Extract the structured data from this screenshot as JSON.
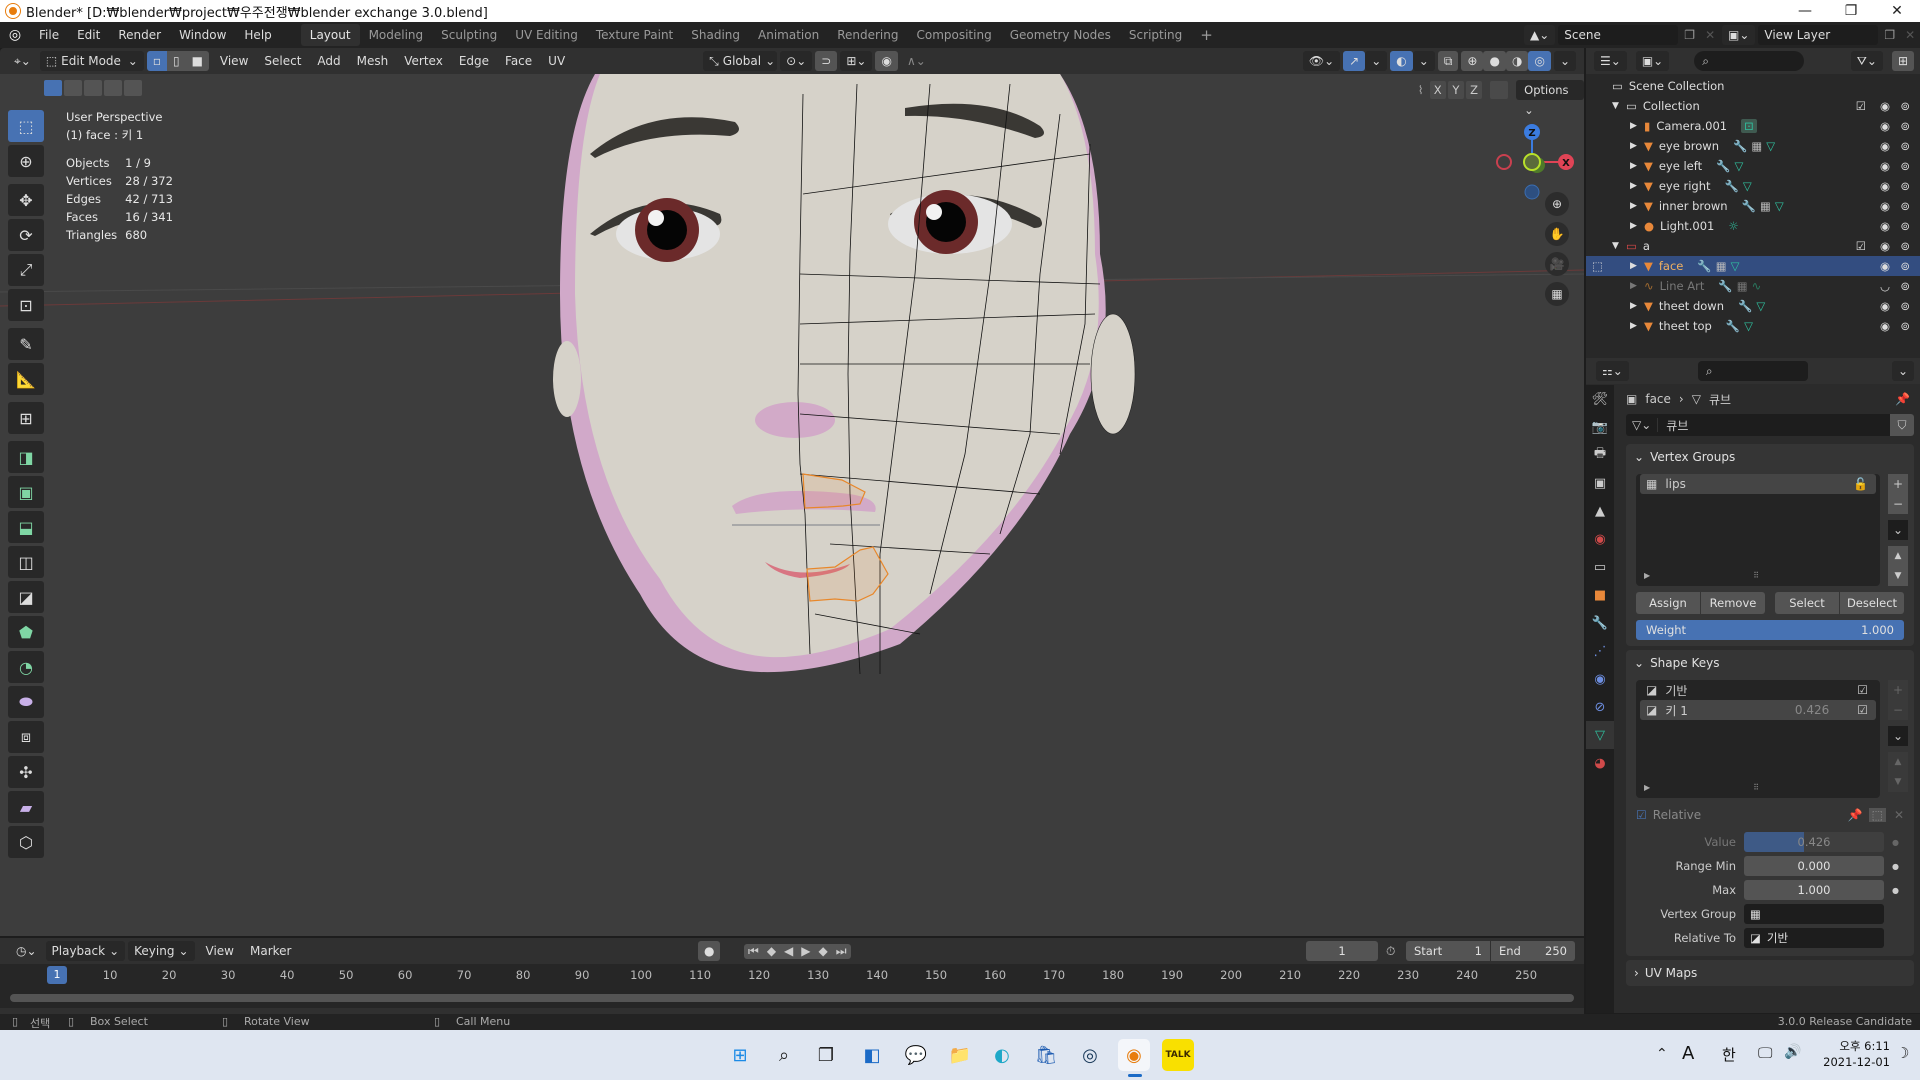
{
  "window": {
    "title": "Blender* [D:₩blender₩project₩우주전쟁₩blender exchange 3.0.blend]",
    "controls": [
      "—",
      "❐",
      "✕"
    ]
  },
  "menu": {
    "items": [
      "File",
      "Edit",
      "Render",
      "Window",
      "Help"
    ],
    "workspaces": [
      "Layout",
      "Modeling",
      "Sculpting",
      "UV Editing",
      "Texture Paint",
      "Shading",
      "Animation",
      "Rendering",
      "Compositing",
      "Geometry Nodes",
      "Scripting"
    ],
    "active_workspace": "Layout",
    "add_workspace": "+",
    "scene": "Scene",
    "view_layer": "View Layer"
  },
  "viewport_header": {
    "mode": "Edit Mode",
    "menus": [
      "View",
      "Select",
      "Add",
      "Mesh",
      "Vertex",
      "Edge",
      "Face",
      "UV"
    ],
    "transform_orientation": "Global",
    "mirror_axes": [
      "X",
      "Y",
      "Z"
    ],
    "options_label": "Options"
  },
  "viewport_overlay": {
    "view_name": "User Perspective",
    "object_info": "(1) face : 키 1",
    "stats": [
      {
        "label": "Objects",
        "value": "1 / 9"
      },
      {
        "label": "Vertices",
        "value": "28 / 372"
      },
      {
        "label": "Edges",
        "value": "42 / 713"
      },
      {
        "label": "Faces",
        "value": "16 / 341"
      },
      {
        "label": "Triangles",
        "value": "680"
      }
    ],
    "gizmo_axes": [
      "Z",
      "X"
    ]
  },
  "outliner": {
    "root": "Scene Collection",
    "items": [
      {
        "name": "Collection",
        "type": "collection",
        "depth": 1
      },
      {
        "name": "Camera.001",
        "type": "camera",
        "depth": 2
      },
      {
        "name": "eye brown",
        "type": "mesh",
        "depth": 2
      },
      {
        "name": "eye left",
        "type": "mesh",
        "depth": 2
      },
      {
        "name": "eye right",
        "type": "mesh",
        "depth": 2
      },
      {
        "name": "inner brown",
        "type": "mesh",
        "depth": 2
      },
      {
        "name": "Light.001",
        "type": "light",
        "depth": 2
      },
      {
        "name": "a",
        "type": "collection-red",
        "depth": 1
      },
      {
        "name": "face",
        "type": "mesh",
        "depth": 2,
        "selected": true
      },
      {
        "name": "Line Art",
        "type": "lineart",
        "depth": 2,
        "dimmed": true
      },
      {
        "name": "theet down",
        "type": "mesh",
        "depth": 2
      },
      {
        "name": "theet top",
        "type": "mesh",
        "depth": 2
      }
    ]
  },
  "properties": {
    "breadcrumb_object": "face",
    "breadcrumb_data": "큐브",
    "mesh_name": "큐브",
    "vertex_groups": {
      "title": "Vertex Groups",
      "items": [
        "lips"
      ],
      "buttons": [
        "Assign",
        "Remove",
        "Select",
        "Deselect"
      ],
      "weight_label": "Weight",
      "weight_value": "1.000"
    },
    "shape_keys": {
      "title": "Shape Keys",
      "items": [
        {
          "name": "기반",
          "value": ""
        },
        {
          "name": "키 1",
          "value": "0.426"
        }
      ],
      "relative_label": "Relative",
      "value_label": "Value",
      "value": "0.426",
      "value_fraction": 0.426,
      "range_min_label": "Range Min",
      "range_min": "0.000",
      "max_label": "Max",
      "max": "1.000",
      "vertex_group_label": "Vertex Group",
      "vertex_group": "",
      "relative_to_label": "Relative To",
      "relative_to": "기반"
    },
    "uv_maps_title": "UV Maps"
  },
  "timeline": {
    "menus": [
      "Playback",
      "Keying",
      "View",
      "Marker"
    ],
    "current_frame": "1",
    "start_label": "Start",
    "start": "1",
    "end_label": "End",
    "end": "250",
    "ticks": [
      "10",
      "20",
      "30",
      "40",
      "50",
      "60",
      "70",
      "80",
      "90",
      "100",
      "110",
      "120",
      "130",
      "140",
      "150",
      "160",
      "170",
      "180",
      "190",
      "200",
      "210",
      "220",
      "230",
      "240",
      "250"
    ],
    "playhead": "1"
  },
  "statusbar": {
    "hints": [
      "선택",
      "Box Select",
      "Rotate View",
      "Call Menu"
    ],
    "version": "3.0.0 Release Candidate"
  },
  "taskbar": {
    "apps": [
      "start",
      "search",
      "task-view",
      "widgets",
      "teams-chat",
      "file-explorer",
      "edge",
      "store",
      "steam",
      "blender",
      "kakaotalk"
    ],
    "tray": {
      "ime_a": "A",
      "ime_han": "한",
      "time": "오후 6:11",
      "date": "2021-12-01"
    }
  }
}
